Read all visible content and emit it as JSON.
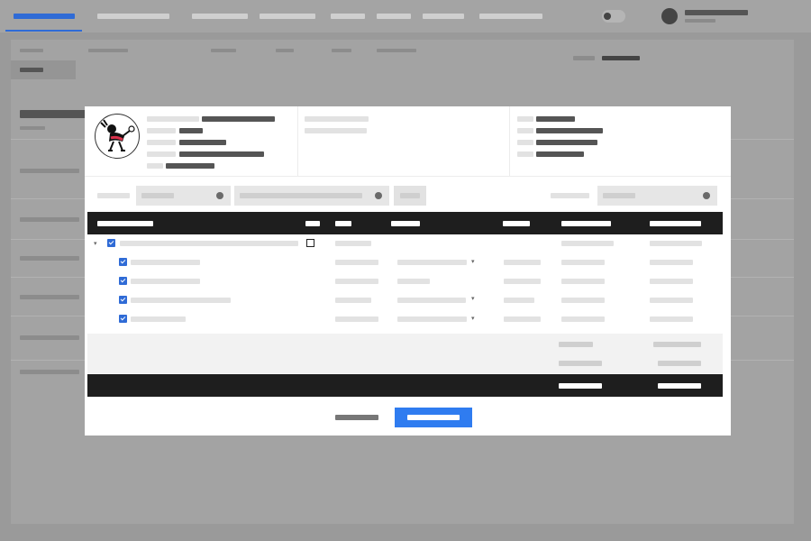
{
  "colors": {
    "accent": "#2f6bd6",
    "confirm_button": "#2f7cf0",
    "table_header": "#1e1e1e",
    "backdrop": "#9a9a9a"
  },
  "top_nav": {
    "tab_count": 8,
    "active_tab_index": 0,
    "has_theme_toggle": true,
    "has_user_avatar": true
  },
  "dialog": {
    "logo_icon": "mascot-logo-icon",
    "header_columns": 3,
    "filters": {
      "dropdowns": 3,
      "has_button": true
    },
    "table": {
      "columns": 7,
      "tree_rows": 5,
      "first_row_expandable": true,
      "checked_rows": [
        true,
        true,
        true,
        true,
        true
      ],
      "summary_rows": 2,
      "has_footer_totals": true
    },
    "buttons": {
      "cancel_icon": "text-button",
      "confirm_icon": "primary-button"
    }
  }
}
